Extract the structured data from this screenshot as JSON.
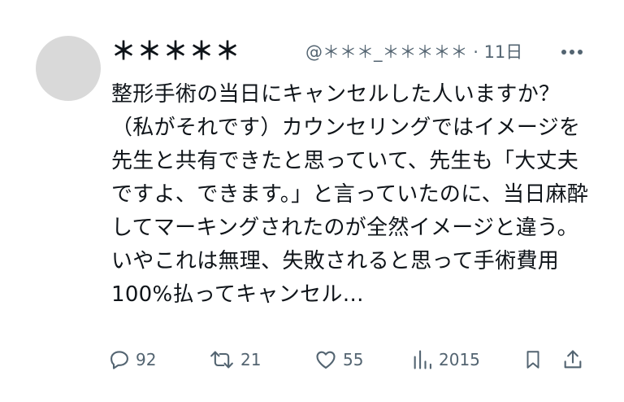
{
  "post": {
    "author_name": "＊＊＊＊＊",
    "handle": "@＊＊＊_＊＊＊＊＊",
    "separator": "·",
    "time": "11日",
    "text": "整形手術の当日にキャンセルした人いますか？（私がそれです）カウンセリングではイメージを先生と共有できたと思っていて、先生も「大丈夫ですよ、できます。」と言っていたのに、当日麻酔してマーキングされたのが全然イメージと違う。いやこれは無理、失敗されると思って手術費用100%払ってキャンセル…"
  },
  "actions": {
    "replies": "92",
    "reposts": "21",
    "likes": "55",
    "views": "2015"
  },
  "icons": {
    "more": "more-dots-icon",
    "reply": "reply-bubble-icon",
    "repost": "repost-arrows-icon",
    "like": "heart-icon",
    "views": "views-bars-icon",
    "bookmark": "bookmark-icon",
    "share": "share-upload-icon"
  },
  "colors": {
    "text": "#0f1419",
    "secondary": "#536471",
    "avatar": "#d9d9d9"
  }
}
